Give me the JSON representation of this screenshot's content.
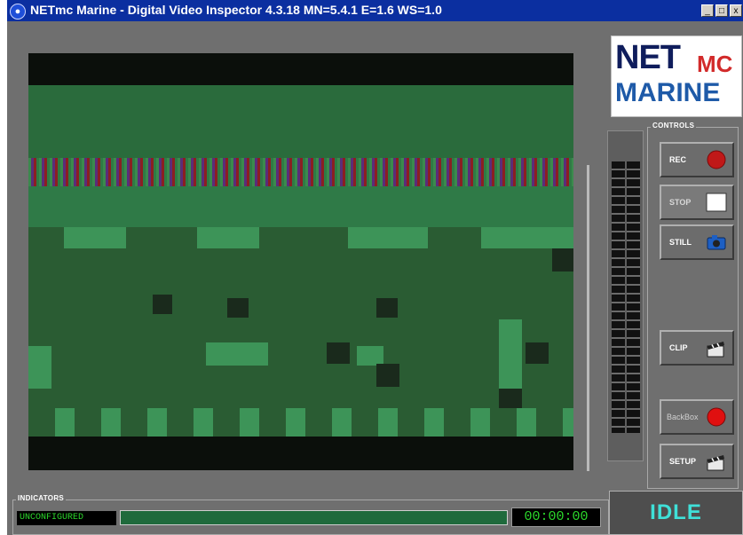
{
  "window": {
    "title": "NETmc Marine - Digital Video Inspector 4.3.18 MN=5.4.1 E=1.6 WS=1.0",
    "minimize_glyph": "_",
    "maximize_glyph": "□",
    "close_glyph": "x"
  },
  "logo": {
    "net": "NET",
    "mc": "MC",
    "marine": "MARINE"
  },
  "controls": {
    "group_label": "CONTROLS",
    "buttons": [
      {
        "label": "REC",
        "icon": "record-icon"
      },
      {
        "label": "STOP",
        "icon": "stop-icon"
      },
      {
        "label": "STILL",
        "icon": "camera-icon"
      },
      {
        "label": "CLIP",
        "icon": "clapperboard-icon"
      },
      {
        "label": "BackBox",
        "icon": "record-icon"
      },
      {
        "label": "SETUP",
        "icon": "clapperboard-icon"
      }
    ]
  },
  "indicators": {
    "group_label": "INDICATORS",
    "status_text": "UNCONFIGURED",
    "timecode": "00:00:00"
  },
  "state": {
    "status": "IDLE"
  },
  "colors": {
    "title_bar": "#0b2fa0",
    "window_bg": "#6f6f6f",
    "led_green": "#2bd82b",
    "status_cyan": "#3fe0d8",
    "rec_red": "#c01818"
  }
}
